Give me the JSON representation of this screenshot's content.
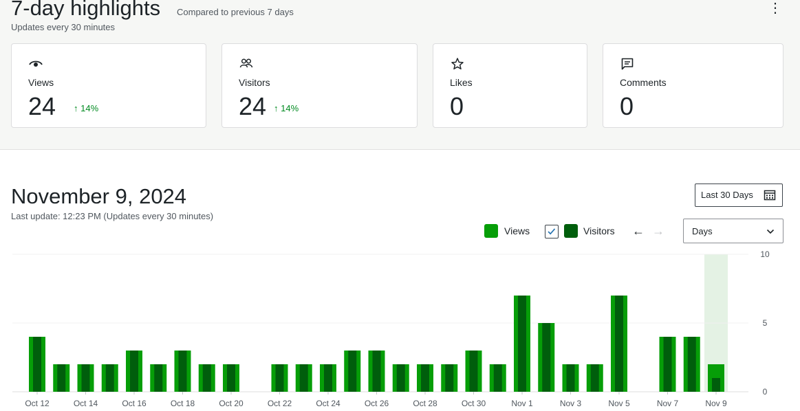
{
  "highlights": {
    "title": "7-day highlights",
    "compare": "Compared to previous 7 days",
    "updates": "Updates every 30 minutes",
    "more_icon": "more-vertical-icon",
    "cards": [
      {
        "label": "Views",
        "value": "24",
        "delta": "↑ 14%",
        "icon": "eye-icon"
      },
      {
        "label": "Visitors",
        "value": "24",
        "delta": "↑ 14%",
        "icon": "people-icon"
      },
      {
        "label": "Likes",
        "value": "0",
        "delta": "",
        "icon": "star-icon"
      },
      {
        "label": "Comments",
        "value": "0",
        "delta": "",
        "icon": "comment-icon"
      }
    ]
  },
  "chart_section": {
    "date": "November 9, 2024",
    "last_update": "Last update: 12:23 PM (Updates every 30 minutes)",
    "range_button": "Last 30 Days",
    "legend": {
      "views": "Views",
      "visitors": "Visitors"
    },
    "period_select": "Days",
    "colors": {
      "views": "#069e08",
      "visitors": "#005e0c",
      "highlight": "#e4f2e4"
    }
  },
  "chart_data": {
    "type": "bar",
    "categories": [
      "Oct 12",
      "Oct 13",
      "Oct 14",
      "Oct 15",
      "Oct 16",
      "Oct 17",
      "Oct 18",
      "Oct 19",
      "Oct 20",
      "Oct 21",
      "Oct 22",
      "Oct 23",
      "Oct 24",
      "Oct 25",
      "Oct 26",
      "Oct 27",
      "Oct 28",
      "Oct 29",
      "Oct 30",
      "Oct 31",
      "Nov 1",
      "Nov 2",
      "Nov 3",
      "Nov 4",
      "Nov 5",
      "Nov 6",
      "Nov 7",
      "Nov 8",
      "Nov 9"
    ],
    "tick_labels": [
      "Oct 12",
      "Oct 14",
      "Oct 16",
      "Oct 18",
      "Oct 20",
      "Oct 22",
      "Oct 24",
      "Oct 26",
      "Oct 28",
      "Oct 30",
      "Nov 1",
      "Nov 3",
      "Nov 5",
      "Nov 7",
      "Nov 9"
    ],
    "series": [
      {
        "name": "Views",
        "values": [
          4,
          2,
          2,
          2,
          3,
          2,
          3,
          2,
          2,
          0,
          2,
          2,
          2,
          3,
          3,
          2,
          2,
          2,
          3,
          2,
          7,
          5,
          2,
          2,
          7,
          0,
          4,
          4,
          2
        ]
      },
      {
        "name": "Visitors",
        "values": [
          4,
          2,
          2,
          2,
          3,
          2,
          3,
          2,
          2,
          0,
          2,
          2,
          2,
          3,
          3,
          2,
          2,
          2,
          3,
          2,
          7,
          5,
          2,
          2,
          7,
          0,
          4,
          4,
          1
        ]
      }
    ],
    "y_ticks": [
      "0",
      "5",
      "10"
    ],
    "ylim": [
      0,
      10
    ],
    "highlighted": "Nov 9",
    "grid": true
  }
}
